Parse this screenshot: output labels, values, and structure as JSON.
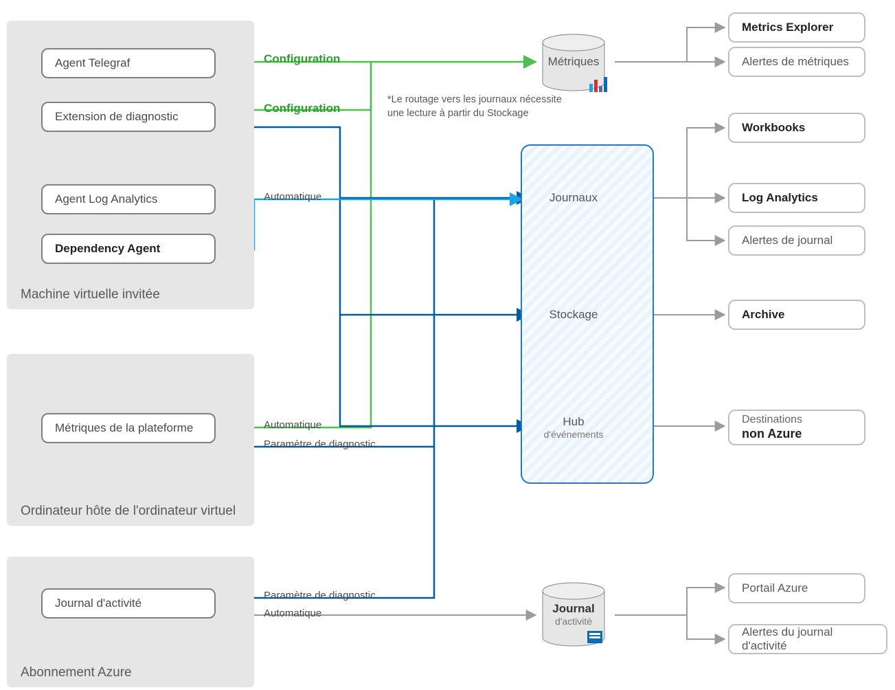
{
  "groups": {
    "vm_guest": {
      "title": "Machine virtuelle invitée",
      "items": {
        "telegraf": {
          "label": "Agent Telegraf"
        },
        "diag_ext": {
          "label": "Extension de diagnostic"
        },
        "la_agent": {
          "label": "Agent Log Analytics"
        },
        "dep_agent": {
          "label": "Dependency Agent"
        }
      }
    },
    "vm_host": {
      "title": "Ordinateur hôte de l'ordinateur virtuel",
      "items": {
        "platform_metrics": {
          "label": "Métriques de la plateforme"
        }
      }
    },
    "subscription": {
      "title": "Abonnement Azure",
      "items": {
        "activity_log": {
          "label": "Journal d'activité"
        }
      }
    }
  },
  "edge_labels": {
    "config1": "Configuration",
    "config2": "Configuration",
    "auto1": "Automatique",
    "auto2": "Automatique",
    "diag_setting": "Paramètre de diagnostic",
    "diag_setting2": "Paramètre de diagnostic",
    "auto3": "Automatique"
  },
  "stores": {
    "metrics": {
      "title": "Métriques"
    },
    "logs": {
      "title": "Journaux"
    },
    "storage": {
      "title": "Stockage"
    },
    "eventhub": {
      "title_top": "Hub",
      "title_sub": "d'événements"
    },
    "activity": {
      "title_top": "Journal",
      "title_sub": "d'activité"
    }
  },
  "outcomes": {
    "metrics_explorer": {
      "label": "Metrics Explorer"
    },
    "metric_alerts": {
      "label": "Alertes de métriques"
    },
    "workbooks": {
      "label": "Workbooks"
    },
    "log_analytics": {
      "label": "Log Analytics"
    },
    "log_alerts": {
      "label": "Alertes de journal"
    },
    "archive": {
      "label": "Archive"
    },
    "non_azure": {
      "line1": "Destinations",
      "line2": "non Azure"
    },
    "portal": {
      "label": "Portail Azure"
    },
    "activity_alerts": {
      "label": "Alertes du journal d'activité"
    }
  },
  "footnote": {
    "line1": "*Le routage vers les journaux nécessite",
    "line2": "une lecture à partir du Stockage"
  },
  "colors": {
    "green": "#4fbf4f",
    "teal": "#1aa4e0",
    "blue": "#005ba1",
    "grey": "#9b9b9b"
  }
}
